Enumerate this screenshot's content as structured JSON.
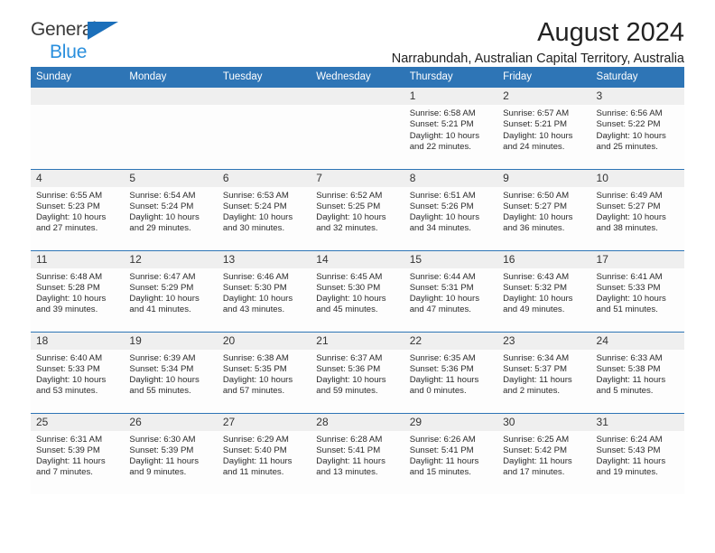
{
  "brand": {
    "name_part1": "General",
    "name_part2": "Blue",
    "logo_icon": "triangle-flag-icon"
  },
  "header": {
    "title": "August 2024",
    "subtitle": "Narrabundah, Australian Capital Territory, Australia"
  },
  "colors": {
    "header_blue": "#2e75b6",
    "brand_dark_blue": "#1b6fba",
    "brand_light_blue": "#2a8fdd",
    "daynum_background": "#efefef"
  },
  "calendar": {
    "weekday_headers": [
      "Sunday",
      "Monday",
      "Tuesday",
      "Wednesday",
      "Thursday",
      "Friday",
      "Saturday"
    ],
    "weeks": [
      [
        {
          "day": "",
          "lines": []
        },
        {
          "day": "",
          "lines": []
        },
        {
          "day": "",
          "lines": []
        },
        {
          "day": "",
          "lines": []
        },
        {
          "day": "1",
          "lines": [
            "Sunrise: 6:58 AM",
            "Sunset: 5:21 PM",
            "Daylight: 10 hours",
            "and 22 minutes."
          ]
        },
        {
          "day": "2",
          "lines": [
            "Sunrise: 6:57 AM",
            "Sunset: 5:21 PM",
            "Daylight: 10 hours",
            "and 24 minutes."
          ]
        },
        {
          "day": "3",
          "lines": [
            "Sunrise: 6:56 AM",
            "Sunset: 5:22 PM",
            "Daylight: 10 hours",
            "and 25 minutes."
          ]
        }
      ],
      [
        {
          "day": "4",
          "lines": [
            "Sunrise: 6:55 AM",
            "Sunset: 5:23 PM",
            "Daylight: 10 hours",
            "and 27 minutes."
          ]
        },
        {
          "day": "5",
          "lines": [
            "Sunrise: 6:54 AM",
            "Sunset: 5:24 PM",
            "Daylight: 10 hours",
            "and 29 minutes."
          ]
        },
        {
          "day": "6",
          "lines": [
            "Sunrise: 6:53 AM",
            "Sunset: 5:24 PM",
            "Daylight: 10 hours",
            "and 30 minutes."
          ]
        },
        {
          "day": "7",
          "lines": [
            "Sunrise: 6:52 AM",
            "Sunset: 5:25 PM",
            "Daylight: 10 hours",
            "and 32 minutes."
          ]
        },
        {
          "day": "8",
          "lines": [
            "Sunrise: 6:51 AM",
            "Sunset: 5:26 PM",
            "Daylight: 10 hours",
            "and 34 minutes."
          ]
        },
        {
          "day": "9",
          "lines": [
            "Sunrise: 6:50 AM",
            "Sunset: 5:27 PM",
            "Daylight: 10 hours",
            "and 36 minutes."
          ]
        },
        {
          "day": "10",
          "lines": [
            "Sunrise: 6:49 AM",
            "Sunset: 5:27 PM",
            "Daylight: 10 hours",
            "and 38 minutes."
          ]
        }
      ],
      [
        {
          "day": "11",
          "lines": [
            "Sunrise: 6:48 AM",
            "Sunset: 5:28 PM",
            "Daylight: 10 hours",
            "and 39 minutes."
          ]
        },
        {
          "day": "12",
          "lines": [
            "Sunrise: 6:47 AM",
            "Sunset: 5:29 PM",
            "Daylight: 10 hours",
            "and 41 minutes."
          ]
        },
        {
          "day": "13",
          "lines": [
            "Sunrise: 6:46 AM",
            "Sunset: 5:30 PM",
            "Daylight: 10 hours",
            "and 43 minutes."
          ]
        },
        {
          "day": "14",
          "lines": [
            "Sunrise: 6:45 AM",
            "Sunset: 5:30 PM",
            "Daylight: 10 hours",
            "and 45 minutes."
          ]
        },
        {
          "day": "15",
          "lines": [
            "Sunrise: 6:44 AM",
            "Sunset: 5:31 PM",
            "Daylight: 10 hours",
            "and 47 minutes."
          ]
        },
        {
          "day": "16",
          "lines": [
            "Sunrise: 6:43 AM",
            "Sunset: 5:32 PM",
            "Daylight: 10 hours",
            "and 49 minutes."
          ]
        },
        {
          "day": "17",
          "lines": [
            "Sunrise: 6:41 AM",
            "Sunset: 5:33 PM",
            "Daylight: 10 hours",
            "and 51 minutes."
          ]
        }
      ],
      [
        {
          "day": "18",
          "lines": [
            "Sunrise: 6:40 AM",
            "Sunset: 5:33 PM",
            "Daylight: 10 hours",
            "and 53 minutes."
          ]
        },
        {
          "day": "19",
          "lines": [
            "Sunrise: 6:39 AM",
            "Sunset: 5:34 PM",
            "Daylight: 10 hours",
            "and 55 minutes."
          ]
        },
        {
          "day": "20",
          "lines": [
            "Sunrise: 6:38 AM",
            "Sunset: 5:35 PM",
            "Daylight: 10 hours",
            "and 57 minutes."
          ]
        },
        {
          "day": "21",
          "lines": [
            "Sunrise: 6:37 AM",
            "Sunset: 5:36 PM",
            "Daylight: 10 hours",
            "and 59 minutes."
          ]
        },
        {
          "day": "22",
          "lines": [
            "Sunrise: 6:35 AM",
            "Sunset: 5:36 PM",
            "Daylight: 11 hours",
            "and 0 minutes."
          ]
        },
        {
          "day": "23",
          "lines": [
            "Sunrise: 6:34 AM",
            "Sunset: 5:37 PM",
            "Daylight: 11 hours",
            "and 2 minutes."
          ]
        },
        {
          "day": "24",
          "lines": [
            "Sunrise: 6:33 AM",
            "Sunset: 5:38 PM",
            "Daylight: 11 hours",
            "and 5 minutes."
          ]
        }
      ],
      [
        {
          "day": "25",
          "lines": [
            "Sunrise: 6:31 AM",
            "Sunset: 5:39 PM",
            "Daylight: 11 hours",
            "and 7 minutes."
          ]
        },
        {
          "day": "26",
          "lines": [
            "Sunrise: 6:30 AM",
            "Sunset: 5:39 PM",
            "Daylight: 11 hours",
            "and 9 minutes."
          ]
        },
        {
          "day": "27",
          "lines": [
            "Sunrise: 6:29 AM",
            "Sunset: 5:40 PM",
            "Daylight: 11 hours",
            "and 11 minutes."
          ]
        },
        {
          "day": "28",
          "lines": [
            "Sunrise: 6:28 AM",
            "Sunset: 5:41 PM",
            "Daylight: 11 hours",
            "and 13 minutes."
          ]
        },
        {
          "day": "29",
          "lines": [
            "Sunrise: 6:26 AM",
            "Sunset: 5:41 PM",
            "Daylight: 11 hours",
            "and 15 minutes."
          ]
        },
        {
          "day": "30",
          "lines": [
            "Sunrise: 6:25 AM",
            "Sunset: 5:42 PM",
            "Daylight: 11 hours",
            "and 17 minutes."
          ]
        },
        {
          "day": "31",
          "lines": [
            "Sunrise: 6:24 AM",
            "Sunset: 5:43 PM",
            "Daylight: 11 hours",
            "and 19 minutes."
          ]
        }
      ]
    ]
  }
}
